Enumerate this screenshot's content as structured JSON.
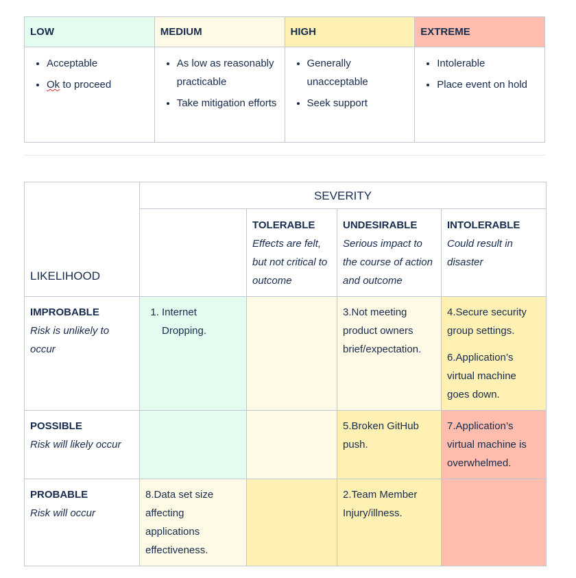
{
  "colors": {
    "green": "#e3fcef",
    "cream": "#fffae6",
    "yellow": "#fff0b3",
    "red": "#ffbdad",
    "border": "#c1c7d0",
    "text": "#172b4d"
  },
  "legend": {
    "headers": [
      "LOW",
      "MEDIUM",
      "HIGH",
      "EXTREME"
    ],
    "low": [
      "Acceptable",
      "Ok",
      "to proceed"
    ],
    "medium": [
      "As low as reasonably practicable",
      "Take mitigation efforts"
    ],
    "high": [
      "Generally unacceptable",
      "Seek support"
    ],
    "extreme": [
      "Intolerable",
      "Place event on hold"
    ]
  },
  "matrix": {
    "severity_title": "SEVERITY",
    "likelihood_title": "LIKELIHOOD",
    "columns": [
      {
        "name": "TOLERABLE",
        "desc": "Effects are felt, but not critical to outcome"
      },
      {
        "name": "UNDESIRABLE",
        "desc": "Serious impact to the course of action and outcome"
      },
      {
        "name": "INTOLERABLE",
        "desc": "Could result in disaster"
      }
    ],
    "rows": [
      {
        "name": "IMPROBABLE",
        "desc": "Risk is unlikely to occur"
      },
      {
        "name": "POSSIBLE",
        "desc": "Risk will likely occur"
      },
      {
        "name": "PROBABLE",
        "desc": "Risk will occur"
      }
    ],
    "cells": {
      "r1c0": "Internet Dropping.",
      "r1c2": "3.Not meeting product owners brief/expectation.",
      "r1c3a": "4.Secure security group settings.",
      "r1c3b": "6.Application’s virtual machine goes down.",
      "r2c2": "5.Broken GitHub push.",
      "r2c3": "7.Application’s virtual machine is overwhelmed.",
      "r3c0": "8.Data set size affecting applications effectiveness.",
      "r3c2": "2.Team Member Injury/illness."
    }
  }
}
